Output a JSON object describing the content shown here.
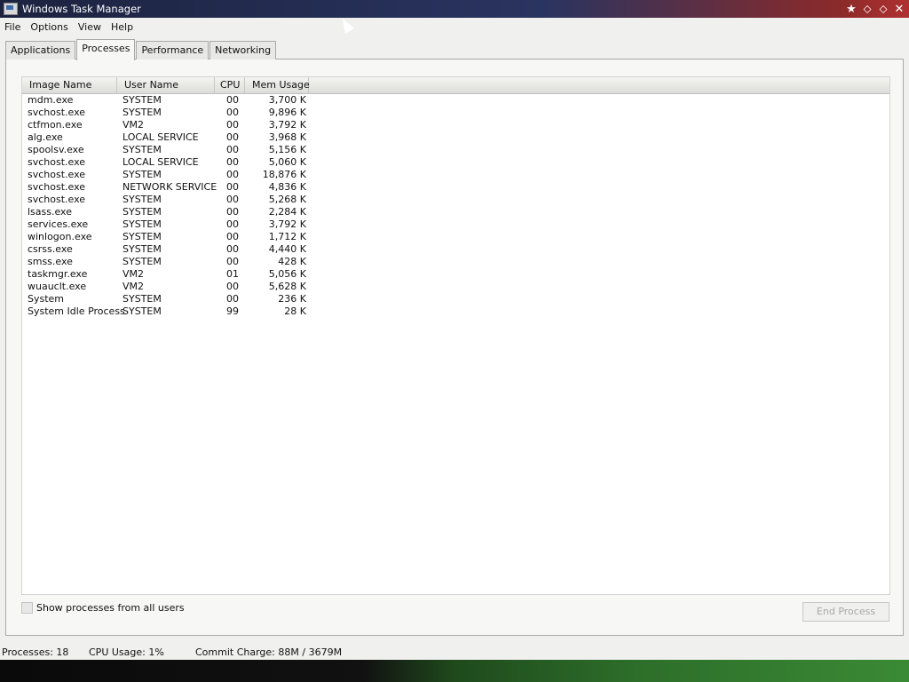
{
  "window": {
    "title": "Windows Task Manager"
  },
  "window_controls": {
    "pin": "★",
    "minimize": "⬦",
    "maximize": "⬦",
    "close": "✕"
  },
  "menu": [
    "File",
    "Options",
    "View",
    "Help"
  ],
  "tabs": [
    "Applications",
    "Processes",
    "Performance",
    "Networking"
  ],
  "active_tab": "Processes",
  "columns": {
    "image_name": "Image Name",
    "user_name": "User Name",
    "cpu": "CPU",
    "mem": "Mem Usage"
  },
  "processes": [
    {
      "name": "mdm.exe",
      "user": "SYSTEM",
      "cpu": "00",
      "mem": "3,700 K"
    },
    {
      "name": "svchost.exe",
      "user": "SYSTEM",
      "cpu": "00",
      "mem": "9,896 K"
    },
    {
      "name": "ctfmon.exe",
      "user": "VM2",
      "cpu": "00",
      "mem": "3,792 K"
    },
    {
      "name": "alg.exe",
      "user": "LOCAL SERVICE",
      "cpu": "00",
      "mem": "3,968 K"
    },
    {
      "name": "spoolsv.exe",
      "user": "SYSTEM",
      "cpu": "00",
      "mem": "5,156 K"
    },
    {
      "name": "svchost.exe",
      "user": "LOCAL SERVICE",
      "cpu": "00",
      "mem": "5,060 K"
    },
    {
      "name": "svchost.exe",
      "user": "SYSTEM",
      "cpu": "00",
      "mem": "18,876 K"
    },
    {
      "name": "svchost.exe",
      "user": "NETWORK SERVICE",
      "cpu": "00",
      "mem": "4,836 K"
    },
    {
      "name": "svchost.exe",
      "user": "SYSTEM",
      "cpu": "00",
      "mem": "5,268 K"
    },
    {
      "name": "lsass.exe",
      "user": "SYSTEM",
      "cpu": "00",
      "mem": "2,284 K"
    },
    {
      "name": "services.exe",
      "user": "SYSTEM",
      "cpu": "00",
      "mem": "3,792 K"
    },
    {
      "name": "winlogon.exe",
      "user": "SYSTEM",
      "cpu": "00",
      "mem": "1,712 K"
    },
    {
      "name": "csrss.exe",
      "user": "SYSTEM",
      "cpu": "00",
      "mem": "4,440 K"
    },
    {
      "name": "smss.exe",
      "user": "SYSTEM",
      "cpu": "00",
      "mem": "428 K"
    },
    {
      "name": "taskmgr.exe",
      "user": "VM2",
      "cpu": "01",
      "mem": "5,056 K"
    },
    {
      "name": "wuauclt.exe",
      "user": "VM2",
      "cpu": "00",
      "mem": "5,628 K"
    },
    {
      "name": "System",
      "user": "SYSTEM",
      "cpu": "00",
      "mem": "236 K"
    },
    {
      "name": "System Idle Process",
      "user": "SYSTEM",
      "cpu": "99",
      "mem": "28 K"
    }
  ],
  "show_all_label": "Show processes from all users",
  "show_all_checked": false,
  "end_process_label": "End Process",
  "status": {
    "processes": "Processes: 18",
    "cpu_usage": "CPU Usage: 1%",
    "commit_charge": "Commit Charge: 88M / 3679M"
  }
}
